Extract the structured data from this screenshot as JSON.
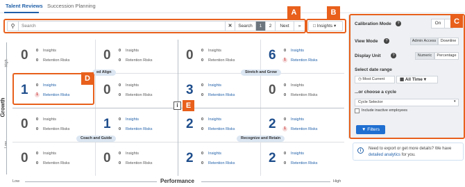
{
  "tabs": [
    {
      "label": "Talent Reviews"
    },
    {
      "label": "Succession Planning"
    }
  ],
  "toolbar": {
    "search_placeholder": "Search",
    "clear_label": "✕",
    "search_label": "Search",
    "pages": [
      "1",
      "2"
    ],
    "current_page": "1",
    "next_label": "Next",
    "last_label": "»",
    "insights_label": "Insights ▾"
  },
  "callouts": [
    "A",
    "B",
    "C",
    "D",
    "E"
  ],
  "grid": {
    "insights_label": "Insights",
    "risks_label": "Retention Risks",
    "cells": [
      {
        "big": "0",
        "insights": "0",
        "risks": "0",
        "blue": false,
        "risk_dot": false
      },
      {
        "big": "0",
        "insights": "0",
        "risks": "0",
        "blue": false,
        "risk_dot": false
      },
      {
        "big": "0",
        "insights": "0",
        "risks": "0",
        "blue": false,
        "risk_dot": false
      },
      {
        "big": "6",
        "insights": "0",
        "risks": "1",
        "blue": true,
        "risk_dot": true
      },
      {
        "big": "1",
        "insights": "0",
        "risks": "1",
        "blue": true,
        "risk_dot": true
      },
      {
        "big": "0",
        "insights": "0",
        "risks": "0",
        "blue": false,
        "risk_dot": false
      },
      {
        "big": "3",
        "insights": "0",
        "risks": "0",
        "blue": true,
        "risk_dot": false
      },
      {
        "big": "0",
        "insights": "0",
        "risks": "0",
        "blue": false,
        "risk_dot": false
      },
      {
        "big": "0",
        "insights": "0",
        "risks": "0",
        "blue": false,
        "risk_dot": false
      },
      {
        "big": "1",
        "insights": "0",
        "risks": "0",
        "blue": true,
        "risk_dot": false
      },
      {
        "big": "2",
        "insights": "0",
        "risks": "0",
        "blue": true,
        "risk_dot": false
      },
      {
        "big": "2",
        "insights": "0",
        "risks": "1",
        "blue": true,
        "risk_dot": true
      },
      {
        "big": "0",
        "insights": "0",
        "risks": "0",
        "blue": false,
        "risk_dot": false
      },
      {
        "big": "0",
        "insights": "0",
        "risks": "0",
        "blue": false,
        "risk_dot": false
      },
      {
        "big": "2",
        "insights": "0",
        "risks": "0",
        "blue": true,
        "risk_dot": false
      },
      {
        "big": "2",
        "insights": "0",
        "risks": "0",
        "blue": true,
        "risk_dot": false
      }
    ],
    "pills": [
      "ed Align",
      "Stretch and Grow",
      "Coach and Guide",
      "Recognize and Retain"
    ],
    "info_icon": "i"
  },
  "axes": {
    "growth": "Growth",
    "high": "High",
    "low": "Low",
    "perf_low": "Low",
    "performance": "Performance",
    "perf_high": "High"
  },
  "panel": {
    "calibration_label": "Calibration Mode",
    "calibration_toggle": "On",
    "view_mode_label": "View Mode",
    "view_modes": [
      "Admin Access",
      "Downline"
    ],
    "display_unit_label": "Display Unit",
    "display_units": [
      "Numeric",
      "Percentage"
    ],
    "date_range_label": "Select date range",
    "most_current": "Most Current",
    "all_time": "All Time ▾",
    "cycle_label": "...or choose a cycle",
    "cycle_selector": "Cycle Selector",
    "include_inactive": "Include inactive employees",
    "filters_label": "Filters"
  },
  "info": {
    "text": "Need to export or get more details? We have",
    "link": "detailed analytics",
    "suffix": "for you."
  },
  "colors": {
    "accent": "#1f5fa8",
    "callout": "#e8601c",
    "risk": "#c33333"
  }
}
